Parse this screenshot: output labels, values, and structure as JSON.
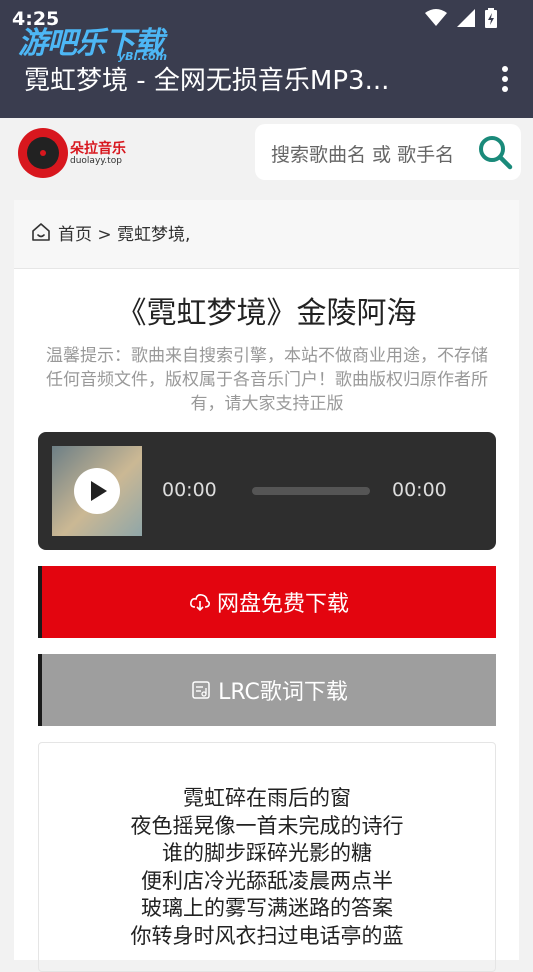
{
  "status_bar": {
    "time": "4:25"
  },
  "watermark": {
    "text": "游吧乐下载",
    "domain": "yBl.com"
  },
  "app_bar": {
    "title": "霓虹梦境 - 全网无损音乐MP3..."
  },
  "header": {
    "logo_text": "朵拉音乐",
    "logo_domain": "duolayy.top",
    "search_placeholder": "搜索歌曲名 或 歌手名"
  },
  "breadcrumb": {
    "text": "首页 > 霓虹梦境,"
  },
  "song": {
    "title": "《霓虹梦境》金陵阿海",
    "notice": "温馨提示：歌曲来自搜索引擎，本站不做商业用途，不存储任何音频文件，版权属于各音乐门户！歌曲版权归原作者所有，请大家支持正版"
  },
  "player": {
    "current_time": "00:00",
    "duration": "00:00",
    "progress": 0
  },
  "buttons": {
    "download_label": "网盘免费下载",
    "lrc_label": "LRC歌词下载"
  },
  "lyrics": [
    "霓虹碎在雨后的窗",
    "夜色摇晃像一首未完成的诗行",
    "谁的脚步踩碎光影的糖",
    "便利店冷光舔舐凌晨两点半",
    "玻璃上的雾写满迷路的答案",
    "你转身时风衣扫过电话亭的蓝"
  ],
  "colors": {
    "app_bar": "#3a3d4f",
    "download": "#e3050f",
    "lrc": "#9e9e9e",
    "player": "#2e2e2e"
  }
}
